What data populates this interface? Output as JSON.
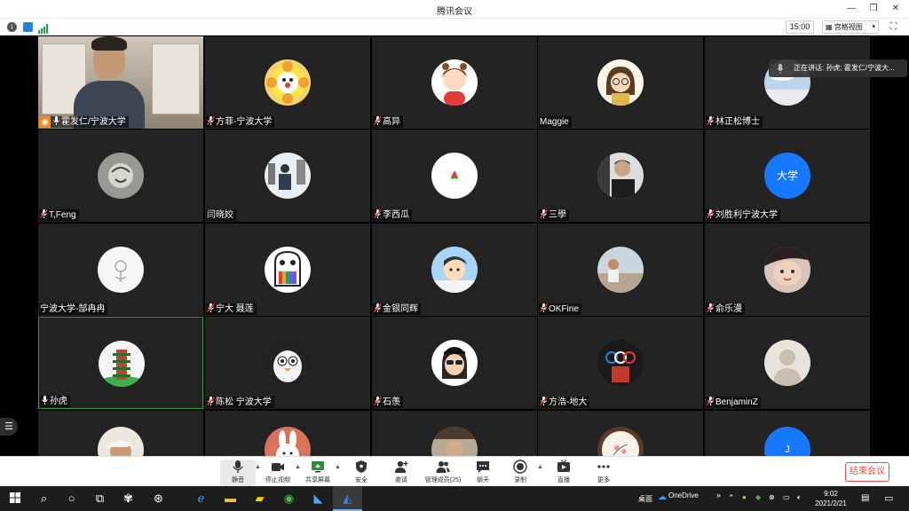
{
  "window": {
    "title": "腾讯会议"
  },
  "topbar": {
    "timer": "15:00",
    "view_mode": "宫格视图"
  },
  "speaking_notice": "正在讲话: 孙虎; 霍发仁/宁波大...",
  "colors": {
    "tile_bg": "#232323",
    "active_border": "#1fa14d",
    "end_button": "#e54b4b",
    "host_badge": "#f08a24"
  },
  "participants": [
    {
      "name": "霍发仁/宁波大学",
      "icon": "host-camera",
      "mic": "on"
    },
    {
      "name": "方菲-宁波大学",
      "icon": "flower-avatar",
      "mic": "muted"
    },
    {
      "name": "高异",
      "icon": "girl-cartoon-avatar",
      "mic": "muted"
    },
    {
      "name": "Maggie",
      "icon": "glasses-cartoon-avatar",
      "mic": "none"
    },
    {
      "name": "林正松博士",
      "icon": "sky-avatar",
      "mic": "muted"
    },
    {
      "name": "T,Feng",
      "icon": "sketch-avatar",
      "mic": "muted"
    },
    {
      "name": "闫晓姣",
      "icon": "city-photo-avatar",
      "mic": "none"
    },
    {
      "name": "李西瓜",
      "icon": "watermelon-avatar",
      "mic": "muted"
    },
    {
      "name": "三學",
      "icon": "portrait-avatar",
      "mic": "muted"
    },
    {
      "name": "刘胜利宁波大学",
      "icon": "text-avatar",
      "avatar_text": "大学",
      "mic": "muted"
    },
    {
      "name": "宁波大学-郜冉冉",
      "icon": "doodle-avatar",
      "mic": "none"
    },
    {
      "name": "宁大 聂莲",
      "icon": "ghost-avatar",
      "mic": "muted"
    },
    {
      "name": "金银同辉",
      "icon": "cartoon-boy-avatar",
      "mic": "muted"
    },
    {
      "name": "OKFine",
      "icon": "beach-avatar",
      "mic": "muted"
    },
    {
      "name": "俞乐漫",
      "icon": "face-avatar",
      "mic": "muted"
    },
    {
      "name": "孙虎",
      "icon": "pagoda-avatar",
      "mic": "on"
    },
    {
      "name": "陈松 宁波大学",
      "icon": "penguin-avatar",
      "mic": "muted"
    },
    {
      "name": "石羡",
      "icon": "memoji-avatar",
      "mic": "muted"
    },
    {
      "name": "方浩-地大",
      "icon": "olympic-avatar",
      "mic": "muted"
    },
    {
      "name": "BenjaminZ",
      "icon": "silhouette-avatar",
      "mic": "muted"
    },
    {
      "name": "",
      "icon": "cap-man-avatar",
      "mic": "none"
    },
    {
      "name": "",
      "icon": "rabbit-avatar",
      "mic": "none"
    },
    {
      "name": "",
      "icon": "portrait2-avatar",
      "mic": "none"
    },
    {
      "name": "",
      "icon": "embroidery-avatar",
      "mic": "none"
    },
    {
      "name": "",
      "icon": "letter-avatar",
      "avatar_text": "J",
      "mic": "none"
    }
  ],
  "toolbar": {
    "mute": "静音",
    "stop_video": "停止视频",
    "share_screen": "共享屏幕",
    "security": "安全",
    "invite": "邀请",
    "manage_members": "管理成员(25)",
    "chat": "聊天",
    "record": "录制",
    "live": "直播",
    "more": "更多",
    "end_meeting": "结束会议"
  },
  "taskbar": {
    "desktop_label": "桌面",
    "onedrive_label": "OneDrive",
    "time": "9:02",
    "date": "2021/2/21"
  }
}
